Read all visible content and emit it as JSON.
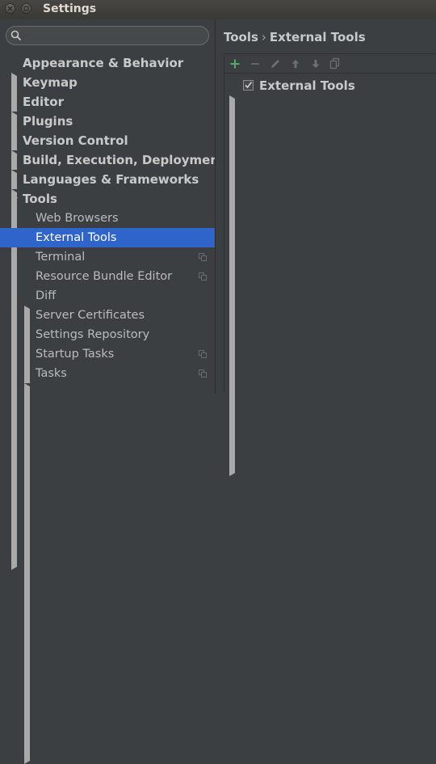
{
  "window": {
    "title": "Settings"
  },
  "search": {
    "placeholder": "",
    "value": ""
  },
  "tree": {
    "items": [
      {
        "label": "Appearance & Behavior",
        "level": 0,
        "expander": "collapsed",
        "selected": false,
        "copy_icon": false
      },
      {
        "label": "Keymap",
        "level": 0,
        "expander": "none",
        "selected": false,
        "copy_icon": false
      },
      {
        "label": "Editor",
        "level": 0,
        "expander": "collapsed",
        "selected": false,
        "copy_icon": false
      },
      {
        "label": "Plugins",
        "level": 0,
        "expander": "none",
        "selected": false,
        "copy_icon": false
      },
      {
        "label": "Version Control",
        "level": 0,
        "expander": "collapsed",
        "selected": false,
        "copy_icon": false
      },
      {
        "label": "Build, Execution, Deployment",
        "level": 0,
        "expander": "collapsed",
        "selected": false,
        "copy_icon": false
      },
      {
        "label": "Languages & Frameworks",
        "level": 0,
        "expander": "collapsed",
        "selected": false,
        "copy_icon": false
      },
      {
        "label": "Tools",
        "level": 0,
        "expander": "expanded",
        "selected": false,
        "copy_icon": false
      },
      {
        "label": "Web Browsers",
        "level": 1,
        "expander": "none",
        "selected": false,
        "copy_icon": false
      },
      {
        "label": "External Tools",
        "level": 1,
        "expander": "none",
        "selected": true,
        "copy_icon": false
      },
      {
        "label": "Terminal",
        "level": 1,
        "expander": "none",
        "selected": false,
        "copy_icon": true
      },
      {
        "label": "Resource Bundle Editor",
        "level": 1,
        "expander": "none",
        "selected": false,
        "copy_icon": true
      },
      {
        "label": "Diff",
        "level": 1,
        "expander": "collapsed",
        "selected": false,
        "copy_icon": false
      },
      {
        "label": "Server Certificates",
        "level": 1,
        "expander": "none",
        "selected": false,
        "copy_icon": false
      },
      {
        "label": "Settings Repository",
        "level": 1,
        "expander": "none",
        "selected": false,
        "copy_icon": false
      },
      {
        "label": "Startup Tasks",
        "level": 1,
        "expander": "none",
        "selected": false,
        "copy_icon": true
      },
      {
        "label": "Tasks",
        "level": 1,
        "expander": "collapsed",
        "selected": false,
        "copy_icon": true
      }
    ]
  },
  "breadcrumb": {
    "parent": "Tools",
    "separator": "›",
    "current": "External Tools"
  },
  "toolbar": {
    "buttons": [
      {
        "name": "add-button",
        "icon": "plus-icon",
        "enabled": true
      },
      {
        "name": "remove-button",
        "icon": "minus-icon",
        "enabled": false
      },
      {
        "name": "edit-button",
        "icon": "pencil-icon",
        "enabled": false
      },
      {
        "name": "move-up-button",
        "icon": "arrow-up-icon",
        "enabled": false
      },
      {
        "name": "move-down-button",
        "icon": "arrow-down-icon",
        "enabled": false
      },
      {
        "name": "copy-button",
        "icon": "copy-icon",
        "enabled": false
      }
    ]
  },
  "tools_list": {
    "items": [
      {
        "label": "External Tools",
        "checked": true,
        "expander": "collapsed"
      }
    ]
  },
  "colors": {
    "background": "#3c3f41",
    "selection": "#2f65ca",
    "text": "#bbbbbb",
    "add_icon": "#59a869"
  }
}
